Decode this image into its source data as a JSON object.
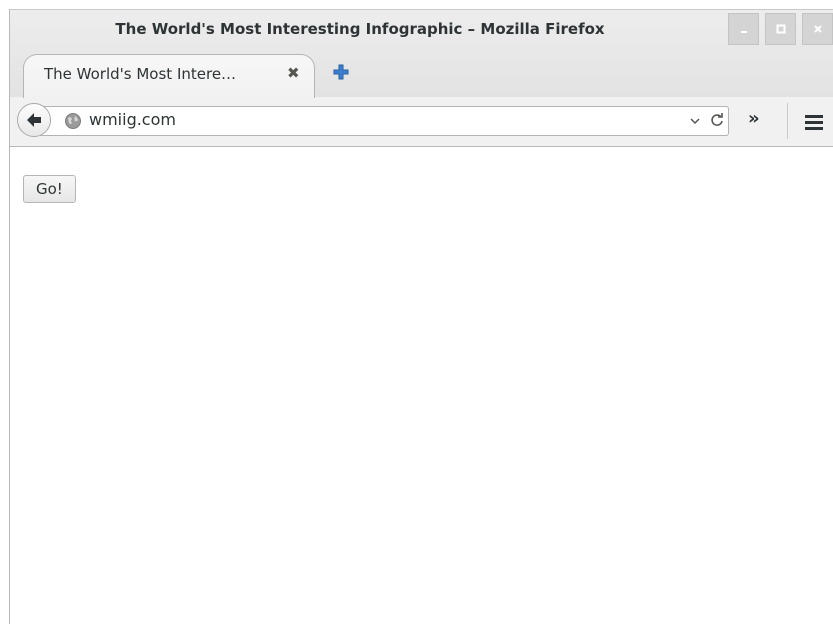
{
  "window": {
    "title": "The World's Most Interesting Infographic – Mozilla Firefox",
    "controls": {
      "minimize": "minimize-icon",
      "maximize": "maximize-icon",
      "close": "close-icon"
    }
  },
  "tabs": [
    {
      "title": "The World's Most Intere…",
      "close_symbol": "✖",
      "active": true
    }
  ],
  "toolbar": {
    "url": "wmiig.com",
    "overflow_symbol": "»",
    "icons": [
      "back-arrow-icon",
      "globe-icon",
      "dropdown-icon",
      "reload-icon",
      "overflow-icon",
      "hamburger-menu-icon",
      "new-tab-plus-icon"
    ]
  },
  "page": {
    "go_button_label": "Go!"
  },
  "colors": {
    "chrome_bg": "#ededed",
    "toolbar_bg": "#f1f1f1",
    "text": "#2e3436",
    "new_tab_plus": "#3a7fd0"
  }
}
